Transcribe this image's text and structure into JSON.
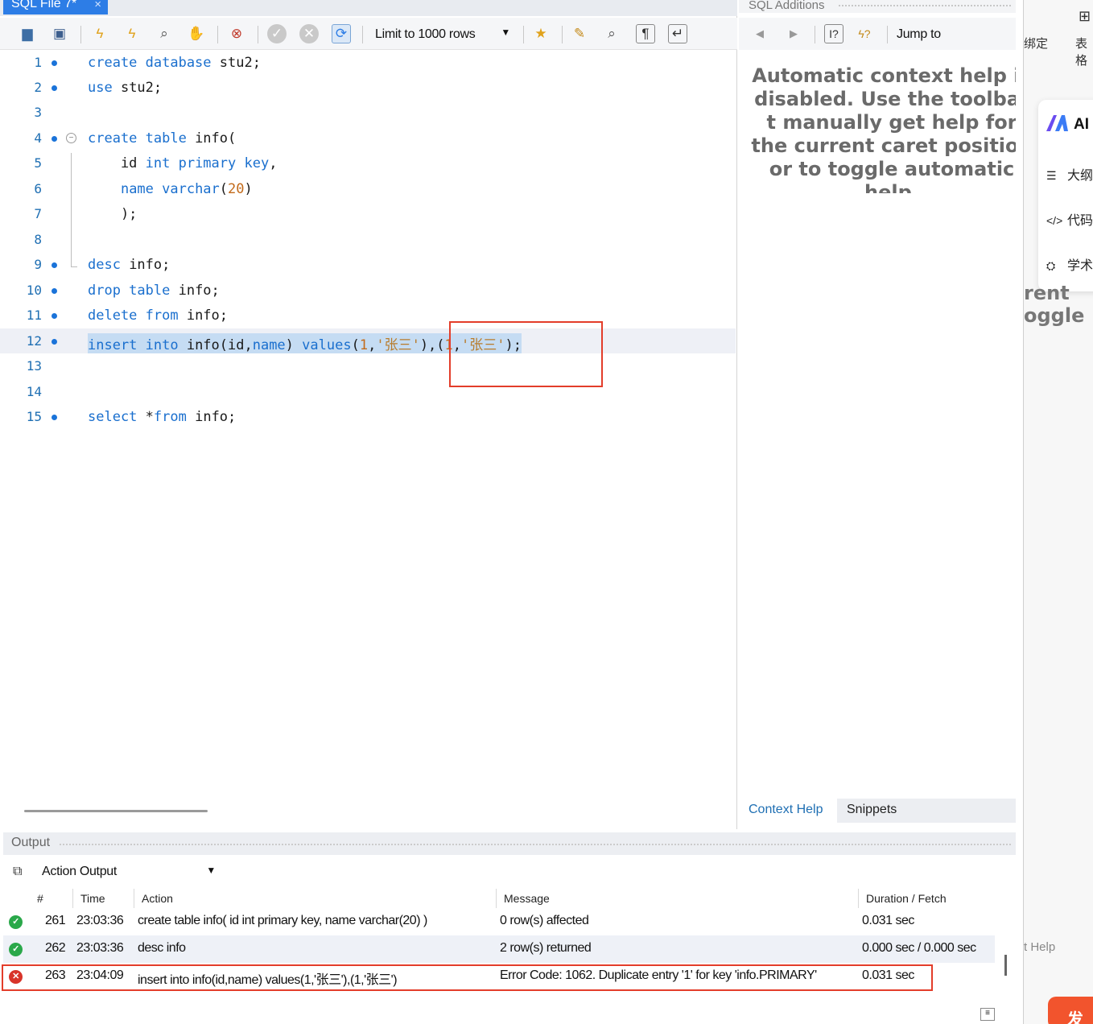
{
  "editor": {
    "tab_title": "SQL File 7*",
    "tab_close": "×",
    "limit_select": "Limit to 1000 rows",
    "lines": [
      {
        "num": "1",
        "text": "create database stu2;"
      },
      {
        "num": "2",
        "text": "use stu2;"
      },
      {
        "num": "3",
        "text": ""
      },
      {
        "num": "4",
        "text": "create table info("
      },
      {
        "num": "5",
        "text": "    id int primary key,"
      },
      {
        "num": "6",
        "text": "    name varchar(20)"
      },
      {
        "num": "7",
        "text": "    );"
      },
      {
        "num": "8",
        "text": ""
      },
      {
        "num": "9",
        "text": "desc info;"
      },
      {
        "num": "10",
        "text": "drop table info;"
      },
      {
        "num": "11",
        "text": "delete from info;"
      },
      {
        "num": "12",
        "text": "insert into info(id,name) values(1,'张三'),(1,'张三');"
      },
      {
        "num": "13",
        "text": ""
      },
      {
        "num": "14",
        "text": ""
      },
      {
        "num": "15",
        "text": "select *from info;"
      }
    ]
  },
  "additions": {
    "title": "SQL Additions",
    "jump_to": "Jump to",
    "help_text": "Automatic context help is disabled. Use the toolbar t manually get help for the current caret position or to toggle automatic help.",
    "tabs": [
      "Context Help",
      "Snippets"
    ]
  },
  "output": {
    "title": "Output",
    "type_select": "Action Output",
    "columns": [
      "#",
      "Time",
      "Action",
      "Message",
      "Duration / Fetch"
    ],
    "rows": [
      {
        "status": "ok",
        "num": "261",
        "time": "23:03:36",
        "action": "create table info( id int primary key,    name varchar(20)    )",
        "message": "0 row(s) affected",
        "duration": "0.031 sec"
      },
      {
        "status": "ok",
        "num": "262",
        "time": "23:03:36",
        "action": "desc info",
        "message": "2 row(s) returned",
        "duration": "0.000 sec / 0.000 sec"
      },
      {
        "status": "error",
        "num": "263",
        "time": "23:04:09",
        "action": "insert into info(id,name) values(1,'张三'),(1,'张三')",
        "message": "Error Code: 1062. Duplicate entry '1' for key 'info.PRIMARY'",
        "duration": "0.031 sec"
      }
    ]
  },
  "overlay": {
    "label_1": "绑定",
    "label_2": "表格",
    "ai_title": "AI",
    "items": [
      "大纲",
      "代码",
      "学术"
    ],
    "ghost_1": "rent",
    "ghost_2": "oggle",
    "help": "t Help",
    "publish": "发布"
  },
  "colors": {
    "accent": "#2d7de6",
    "keyword": "#1a6fce",
    "string": "#b87c2d",
    "error_red": "#d8342a",
    "ok_green": "#2aa84a",
    "highlight_box": "#e33d2a"
  }
}
